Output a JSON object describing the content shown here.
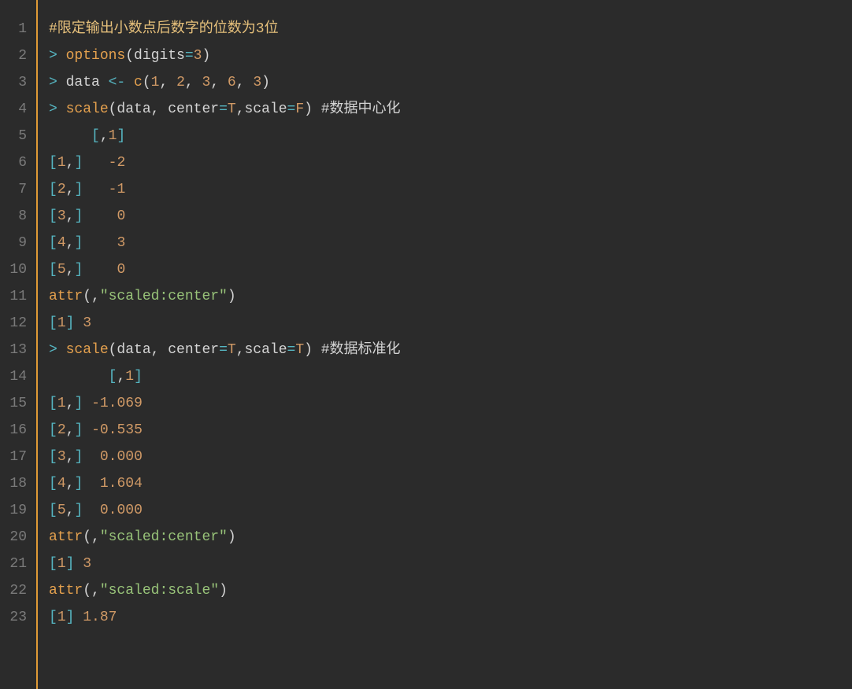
{
  "lines": [
    {
      "num": "1",
      "tokens": [
        {
          "t": "#限定输出小数点后数字的位数为3位",
          "c": "c-comment"
        }
      ]
    },
    {
      "num": "2",
      "tokens": [
        {
          "t": "> ",
          "c": "c-opgt"
        },
        {
          "t": "options",
          "c": "c-fn"
        },
        {
          "t": "(digits",
          "c": "c-default"
        },
        {
          "t": "=",
          "c": "c-turq"
        },
        {
          "t": "3",
          "c": "c-num"
        },
        {
          "t": ")",
          "c": "c-default"
        }
      ]
    },
    {
      "num": "3",
      "tokens": [
        {
          "t": "> ",
          "c": "c-opgt"
        },
        {
          "t": "data ",
          "c": "c-default"
        },
        {
          "t": "<- ",
          "c": "c-turq"
        },
        {
          "t": "c",
          "c": "c-fn"
        },
        {
          "t": "(",
          "c": "c-default"
        },
        {
          "t": "1",
          "c": "c-num"
        },
        {
          "t": ", ",
          "c": "c-default"
        },
        {
          "t": "2",
          "c": "c-num"
        },
        {
          "t": ", ",
          "c": "c-default"
        },
        {
          "t": "3",
          "c": "c-num"
        },
        {
          "t": ", ",
          "c": "c-default"
        },
        {
          "t": "6",
          "c": "c-num"
        },
        {
          "t": ", ",
          "c": "c-default"
        },
        {
          "t": "3",
          "c": "c-num"
        },
        {
          "t": ")",
          "c": "c-default"
        }
      ]
    },
    {
      "num": "4",
      "tokens": [
        {
          "t": "> ",
          "c": "c-opgt"
        },
        {
          "t": "scale",
          "c": "c-fn"
        },
        {
          "t": "(data, center",
          "c": "c-default"
        },
        {
          "t": "=",
          "c": "c-turq"
        },
        {
          "t": "T",
          "c": "c-num"
        },
        {
          "t": ",scale",
          "c": "c-default"
        },
        {
          "t": "=",
          "c": "c-turq"
        },
        {
          "t": "F",
          "c": "c-num"
        },
        {
          "t": ") ",
          "c": "c-default"
        },
        {
          "t": "#数据中心化",
          "c": "c-default"
        }
      ]
    },
    {
      "num": "5",
      "tokens": [
        {
          "t": "     ",
          "c": "c-default"
        },
        {
          "t": "[",
          "c": "c-turq"
        },
        {
          "t": ",",
          "c": "c-default"
        },
        {
          "t": "1",
          "c": "c-num"
        },
        {
          "t": "]",
          "c": "c-turq"
        }
      ]
    },
    {
      "num": "6",
      "tokens": [
        {
          "t": "[",
          "c": "c-turq"
        },
        {
          "t": "1",
          "c": "c-num"
        },
        {
          "t": ",",
          "c": "c-default"
        },
        {
          "t": "]",
          "c": "c-turq"
        },
        {
          "t": "   ",
          "c": "c-default"
        },
        {
          "t": "-2",
          "c": "c-num"
        }
      ]
    },
    {
      "num": "7",
      "tokens": [
        {
          "t": "[",
          "c": "c-turq"
        },
        {
          "t": "2",
          "c": "c-num"
        },
        {
          "t": ",",
          "c": "c-default"
        },
        {
          "t": "]",
          "c": "c-turq"
        },
        {
          "t": "   ",
          "c": "c-default"
        },
        {
          "t": "-1",
          "c": "c-num"
        }
      ]
    },
    {
      "num": "8",
      "tokens": [
        {
          "t": "[",
          "c": "c-turq"
        },
        {
          "t": "3",
          "c": "c-num"
        },
        {
          "t": ",",
          "c": "c-default"
        },
        {
          "t": "]",
          "c": "c-turq"
        },
        {
          "t": "    ",
          "c": "c-default"
        },
        {
          "t": "0",
          "c": "c-num"
        }
      ]
    },
    {
      "num": "9",
      "tokens": [
        {
          "t": "[",
          "c": "c-turq"
        },
        {
          "t": "4",
          "c": "c-num"
        },
        {
          "t": ",",
          "c": "c-default"
        },
        {
          "t": "]",
          "c": "c-turq"
        },
        {
          "t": "    ",
          "c": "c-default"
        },
        {
          "t": "3",
          "c": "c-num"
        }
      ]
    },
    {
      "num": "10",
      "tokens": [
        {
          "t": "[",
          "c": "c-turq"
        },
        {
          "t": "5",
          "c": "c-num"
        },
        {
          "t": ",",
          "c": "c-default"
        },
        {
          "t": "]",
          "c": "c-turq"
        },
        {
          "t": "    ",
          "c": "c-default"
        },
        {
          "t": "0",
          "c": "c-num"
        }
      ]
    },
    {
      "num": "11",
      "tokens": [
        {
          "t": "attr",
          "c": "c-fn"
        },
        {
          "t": "(,",
          "c": "c-default"
        },
        {
          "t": "\"scaled:center\"",
          "c": "c-str"
        },
        {
          "t": ")",
          "c": "c-default"
        }
      ]
    },
    {
      "num": "12",
      "tokens": [
        {
          "t": "[",
          "c": "c-turq"
        },
        {
          "t": "1",
          "c": "c-num"
        },
        {
          "t": "]",
          "c": "c-turq"
        },
        {
          "t": " ",
          "c": "c-default"
        },
        {
          "t": "3",
          "c": "c-num"
        }
      ]
    },
    {
      "num": "13",
      "tokens": [
        {
          "t": "> ",
          "c": "c-opgt"
        },
        {
          "t": "scale",
          "c": "c-fn"
        },
        {
          "t": "(data, center",
          "c": "c-default"
        },
        {
          "t": "=",
          "c": "c-turq"
        },
        {
          "t": "T",
          "c": "c-num"
        },
        {
          "t": ",scale",
          "c": "c-default"
        },
        {
          "t": "=",
          "c": "c-turq"
        },
        {
          "t": "T",
          "c": "c-num"
        },
        {
          "t": ") ",
          "c": "c-default"
        },
        {
          "t": "#数据标准化",
          "c": "c-default"
        }
      ]
    },
    {
      "num": "14",
      "tokens": [
        {
          "t": "       ",
          "c": "c-default"
        },
        {
          "t": "[",
          "c": "c-turq"
        },
        {
          "t": ",",
          "c": "c-default"
        },
        {
          "t": "1",
          "c": "c-num"
        },
        {
          "t": "]",
          "c": "c-turq"
        }
      ]
    },
    {
      "num": "15",
      "tokens": [
        {
          "t": "[",
          "c": "c-turq"
        },
        {
          "t": "1",
          "c": "c-num"
        },
        {
          "t": ",",
          "c": "c-default"
        },
        {
          "t": "]",
          "c": "c-turq"
        },
        {
          "t": " ",
          "c": "c-default"
        },
        {
          "t": "-1.069",
          "c": "c-num"
        }
      ]
    },
    {
      "num": "16",
      "tokens": [
        {
          "t": "[",
          "c": "c-turq"
        },
        {
          "t": "2",
          "c": "c-num"
        },
        {
          "t": ",",
          "c": "c-default"
        },
        {
          "t": "]",
          "c": "c-turq"
        },
        {
          "t": " ",
          "c": "c-default"
        },
        {
          "t": "-0.535",
          "c": "c-num"
        }
      ]
    },
    {
      "num": "17",
      "tokens": [
        {
          "t": "[",
          "c": "c-turq"
        },
        {
          "t": "3",
          "c": "c-num"
        },
        {
          "t": ",",
          "c": "c-default"
        },
        {
          "t": "]",
          "c": "c-turq"
        },
        {
          "t": "  ",
          "c": "c-default"
        },
        {
          "t": "0.000",
          "c": "c-num"
        }
      ]
    },
    {
      "num": "18",
      "tokens": [
        {
          "t": "[",
          "c": "c-turq"
        },
        {
          "t": "4",
          "c": "c-num"
        },
        {
          "t": ",",
          "c": "c-default"
        },
        {
          "t": "]",
          "c": "c-turq"
        },
        {
          "t": "  ",
          "c": "c-default"
        },
        {
          "t": "1.604",
          "c": "c-num"
        }
      ]
    },
    {
      "num": "19",
      "tokens": [
        {
          "t": "[",
          "c": "c-turq"
        },
        {
          "t": "5",
          "c": "c-num"
        },
        {
          "t": ",",
          "c": "c-default"
        },
        {
          "t": "]",
          "c": "c-turq"
        },
        {
          "t": "  ",
          "c": "c-default"
        },
        {
          "t": "0.000",
          "c": "c-num"
        }
      ]
    },
    {
      "num": "20",
      "tokens": [
        {
          "t": "attr",
          "c": "c-fn"
        },
        {
          "t": "(,",
          "c": "c-default"
        },
        {
          "t": "\"scaled:center\"",
          "c": "c-str"
        },
        {
          "t": ")",
          "c": "c-default"
        }
      ]
    },
    {
      "num": "21",
      "tokens": [
        {
          "t": "[",
          "c": "c-turq"
        },
        {
          "t": "1",
          "c": "c-num"
        },
        {
          "t": "]",
          "c": "c-turq"
        },
        {
          "t": " ",
          "c": "c-default"
        },
        {
          "t": "3",
          "c": "c-num"
        }
      ]
    },
    {
      "num": "22",
      "tokens": [
        {
          "t": "attr",
          "c": "c-fn"
        },
        {
          "t": "(,",
          "c": "c-default"
        },
        {
          "t": "\"scaled:scale\"",
          "c": "c-str"
        },
        {
          "t": ")",
          "c": "c-default"
        }
      ]
    },
    {
      "num": "23",
      "tokens": [
        {
          "t": "[",
          "c": "c-turq"
        },
        {
          "t": "1",
          "c": "c-num"
        },
        {
          "t": "]",
          "c": "c-turq"
        },
        {
          "t": " ",
          "c": "c-default"
        },
        {
          "t": "1.87",
          "c": "c-num"
        }
      ]
    }
  ]
}
